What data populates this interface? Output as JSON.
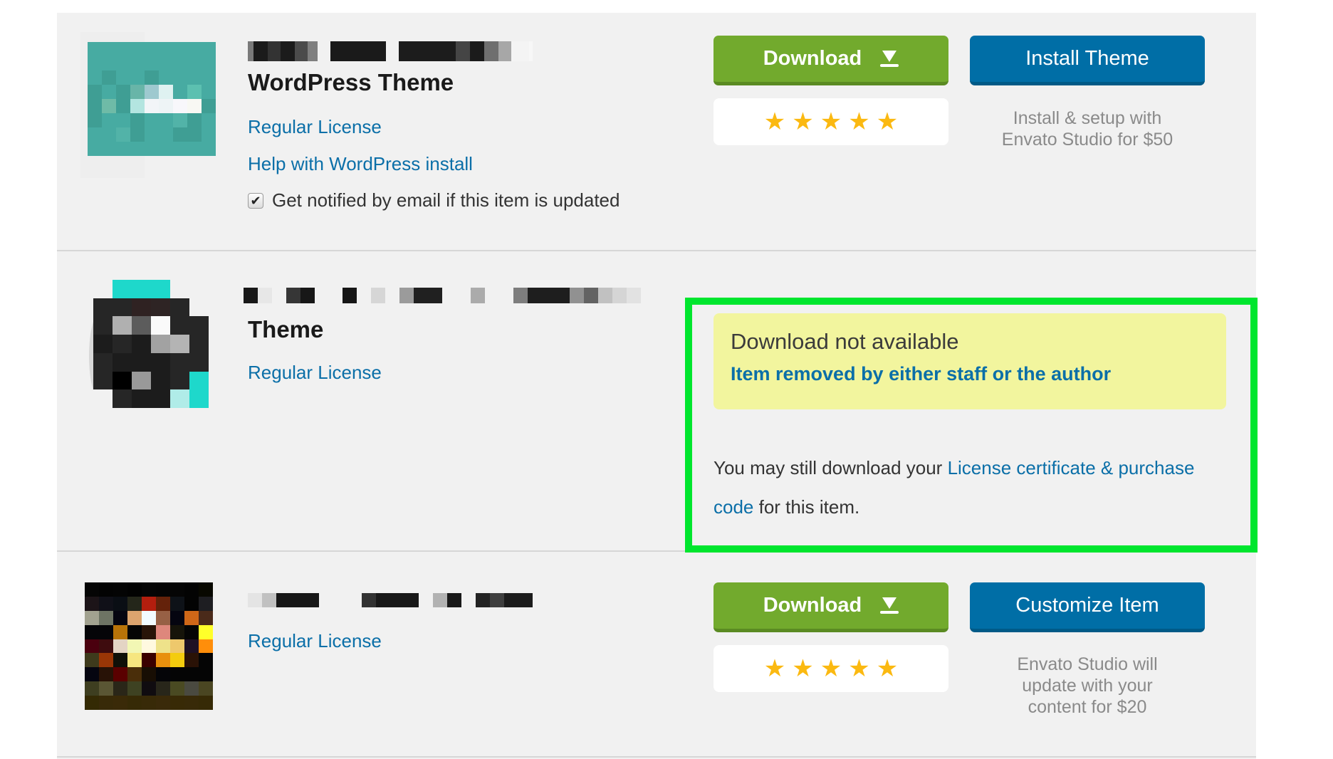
{
  "colors": {
    "panel_bg": "#f1f1f1",
    "link": "#0b6fa8",
    "download_green": "#72aa2d",
    "action_blue": "#006ea6",
    "star": "#fbb911",
    "notice_bg": "#f2f59e",
    "highlight_border": "#00e62e"
  },
  "items": [
    {
      "title_redacted": true,
      "title_visible": "WordPress Theme",
      "license_link": "Regular License",
      "help_link": "Help with WordPress install",
      "notify_checked": true,
      "notify_label": "Get notified by email if this item is updated",
      "download_label": "Download",
      "rating_stars": 5,
      "rating_max": 5,
      "action_label": "Install Theme",
      "action_caption_lines": [
        "Install & setup with",
        "Envato Studio for $50"
      ]
    },
    {
      "title_redacted": true,
      "title_visible": "Theme",
      "license_link": "Regular License",
      "notice_title": "Download not available",
      "notice_reason": "Item removed by either staff or the author",
      "still_text_before": "You may still download your ",
      "still_link": "License certificate & purchase code",
      "still_text_after": " for this item."
    },
    {
      "title_redacted": true,
      "license_link": "Regular License",
      "download_label": "Download",
      "rating_stars": 5,
      "rating_max": 5,
      "action_label": "Customize Item",
      "action_caption_lines": [
        "Envato Studio will",
        "update with your",
        "content for $20"
      ]
    }
  ]
}
